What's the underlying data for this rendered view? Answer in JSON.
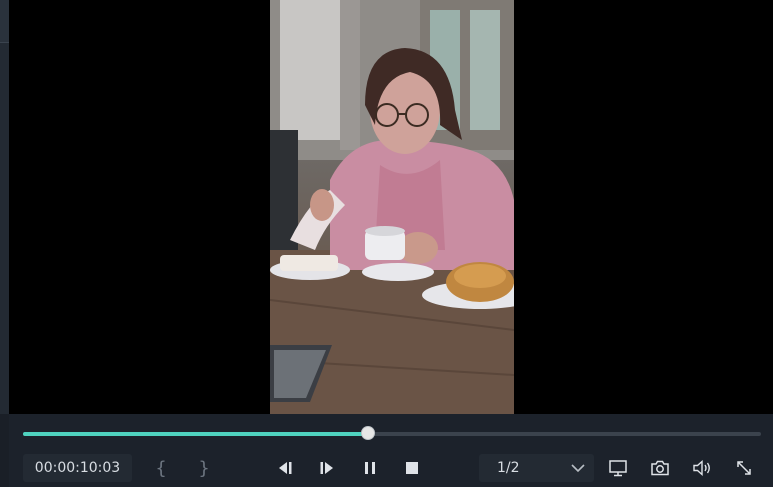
{
  "player": {
    "timecode": "00:00:10:03",
    "progress": 0.468,
    "mark_in_label": "{",
    "mark_out_label": "}",
    "display_ratio": "1/2",
    "accent_color": "#4fd3bf"
  },
  "icons": {
    "prev_frame": "prev-frame-icon",
    "next_frame": "next-frame-icon",
    "pause": "pause-icon",
    "stop": "stop-icon",
    "dropdown": "chevron-down-icon",
    "display": "monitor-icon",
    "snapshot": "camera-icon",
    "volume": "volume-icon",
    "fullscreen": "expand-icon"
  }
}
